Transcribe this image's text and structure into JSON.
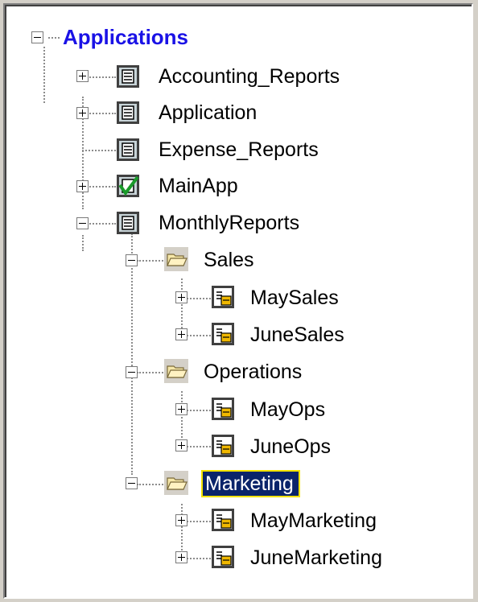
{
  "tree": {
    "root": {
      "label": "Applications"
    },
    "apps": [
      {
        "label": "Accounting_Reports",
        "icon": "application-icon"
      },
      {
        "label": "Application",
        "icon": "application-icon"
      },
      {
        "label": "Expense_Reports",
        "icon": "application-icon"
      },
      {
        "label": "MainApp",
        "icon": "application-checked-icon"
      },
      {
        "label": "MonthlyReports",
        "icon": "application-icon"
      }
    ],
    "folders": [
      {
        "label": "Sales",
        "children": [
          {
            "label": "MaySales"
          },
          {
            "label": "JuneSales"
          }
        ]
      },
      {
        "label": "Operations",
        "children": [
          {
            "label": "MayOps"
          },
          {
            "label": "JuneOps"
          }
        ]
      },
      {
        "label": "Marketing",
        "selected": true,
        "children": [
          {
            "label": "MayMarketing"
          },
          {
            "label": "JuneMarketing"
          }
        ]
      }
    ]
  }
}
